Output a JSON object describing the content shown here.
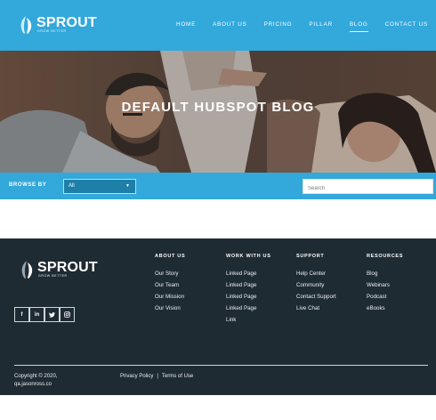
{
  "brand": {
    "name": "SPROUT",
    "tagline": "GROW BETTER"
  },
  "nav": {
    "items": [
      "HOME",
      "ABOUT US",
      "PRICING",
      "PILLAR",
      "BLOG",
      "CONTACT US"
    ],
    "active": "BLOG"
  },
  "hero": {
    "title": "DEFAULT HUBSPOT BLOG"
  },
  "filter": {
    "browse_label": "BROWSE BY",
    "select_value": "All",
    "search_placeholder": "Search"
  },
  "footer": {
    "columns": [
      {
        "title": "ABOUT US",
        "links": [
          "Our Story",
          "Our Team",
          "Our Mission",
          "Our Vision"
        ]
      },
      {
        "title": "WORK WITH US",
        "links": [
          "Linked Page",
          "Linked Page",
          "Linked Page",
          "Linked Page",
          "Link"
        ]
      },
      {
        "title": "SUPPORT",
        "links": [
          "Help Center",
          "Community",
          "Contact Support",
          "Live Chat"
        ]
      },
      {
        "title": "RESOURCES",
        "links": [
          "Blog",
          "Webinars",
          "Podcast",
          "eBooks"
        ]
      }
    ],
    "social": [
      "f",
      "in",
      "t",
      "ig"
    ],
    "copyright_line1": "Copyright © 2020,",
    "copyright_line2": "qa.jasonross.co",
    "legal": {
      "privacy": "Privacy Policy",
      "separator": "|",
      "terms": "Terms of Use"
    }
  },
  "colors": {
    "header_blue": "#33a8db",
    "footer_dark": "#1f2b33",
    "select_blue": "#1e7fa8"
  }
}
